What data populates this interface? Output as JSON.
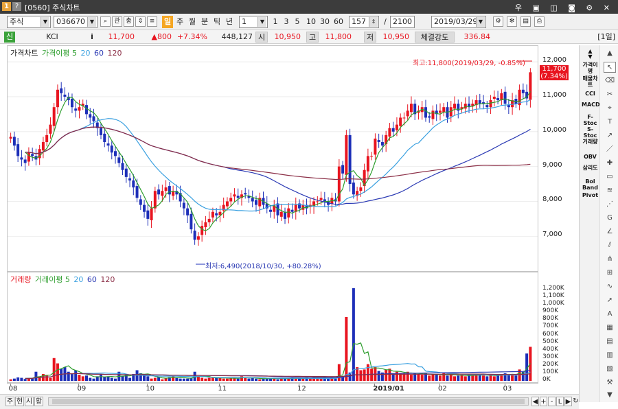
{
  "window": {
    "number": "1",
    "help": "?",
    "title": "[0560] 주식차트",
    "icons": "우 ▣ ◫ ◙ ⚙ ✕"
  },
  "toolbar": {
    "market": "주식",
    "code": "036670",
    "btn_gwan": "관",
    "btn_chong": "총",
    "period_tabs": [
      "일",
      "주",
      "월",
      "분",
      "틱",
      "년"
    ],
    "active_period": "일",
    "interval": "1",
    "quick_intervals": [
      "1",
      "3",
      "5",
      "10",
      "30",
      "60"
    ],
    "count": "157",
    "slash": "/",
    "total": "2100",
    "date": "2019/03/29"
  },
  "quote": {
    "badge": "신",
    "name": "KCI",
    "info": "i",
    "price": "11,700",
    "change": "▲800",
    "change_pct": "+7.34%",
    "volume": "448,127",
    "open_label": "시",
    "open": "10,950",
    "high_label": "고",
    "high": "11,800",
    "low_label": "저",
    "low": "10,950",
    "strength_label": "체결강도",
    "strength": "336.84",
    "period_label": "[1일]"
  },
  "price_panel": {
    "legend": [
      {
        "label": "가격차트",
        "color": "#222222"
      },
      {
        "label": "가격이평 5",
        "color": "#2e9e2e"
      },
      {
        "label": "20",
        "color": "#3aa0e0"
      },
      {
        "label": "60",
        "color": "#2b3ab4"
      },
      {
        "label": "120",
        "color": "#8b2e46"
      }
    ],
    "high_note": "최고:11,800(2019/03/29, -0.85%)",
    "low_note": "최저:6,490(2018/10/30, +80.28%)",
    "last_price": "11,700",
    "last_pct": "(7.34%)"
  },
  "volume_panel": {
    "legend": [
      {
        "label": "거래량",
        "color": "#e8141f"
      },
      {
        "label": "거래이평 5",
        "color": "#2e9e2e"
      },
      {
        "label": "20",
        "color": "#3aa0e0"
      },
      {
        "label": "60",
        "color": "#2b3ab4"
      },
      {
        "label": "120",
        "color": "#8b2e46"
      }
    ]
  },
  "colors": {
    "up": "#e8141f",
    "down": "#1d2fb8",
    "ma5": "#2e9e2e",
    "ma20": "#3aa0e0",
    "ma60": "#2b3ab4",
    "ma120": "#8b2e46"
  },
  "chart_data": [
    {
      "type": "candlestick",
      "title": "",
      "ylim": [
        6200,
        12100
      ],
      "yticks": [
        "12,000",
        "11,000",
        "10,000",
        "9,000",
        "8,000",
        "7,000"
      ],
      "ytick_values": [
        12000,
        11000,
        10000,
        9000,
        8000,
        7000
      ],
      "x_labels": [
        "08",
        "09",
        "10",
        "11",
        "12",
        "2019/01",
        "02",
        "03"
      ],
      "x_label_index": [
        0,
        19,
        38,
        58,
        80,
        101,
        119,
        137
      ],
      "close": [
        9850,
        9600,
        9300,
        9200,
        9100,
        9400,
        9300,
        9200,
        9500,
        9700,
        9900,
        10200,
        10700,
        11200,
        11100,
        11000,
        10900,
        10700,
        10600,
        10700,
        10800,
        10500,
        10400,
        10300,
        10100,
        9900,
        9700,
        9600,
        9400,
        9300,
        9100,
        8900,
        8700,
        8600,
        8400,
        8100,
        7900,
        7700,
        7500,
        7800,
        8300,
        8200,
        8300,
        8400,
        8200,
        8300,
        8200,
        8000,
        7800,
        7600,
        7200,
        6900,
        7000,
        7300,
        7400,
        7500,
        7700,
        7600,
        7700,
        7900,
        8000,
        8100,
        8200,
        8100,
        8200,
        8200,
        8100,
        8000,
        7900,
        8100,
        7900,
        7800,
        7700,
        7900,
        7600,
        7700,
        7500,
        7800,
        7700,
        7900,
        7800,
        7900,
        7800,
        7900,
        8000,
        8000,
        8100,
        8000,
        7900,
        8100,
        8000,
        9000,
        8800,
        9900,
        8500,
        8200,
        8300,
        8400,
        8900,
        9300,
        9300,
        9800,
        9700,
        9600,
        9900,
        10100,
        10000,
        10200,
        10400,
        10400,
        10600,
        10800,
        10500,
        10600,
        10700,
        10400,
        10400,
        10600,
        10500,
        10600,
        10700,
        10400,
        10700,
        10800,
        10600,
        10700,
        10800,
        10700,
        10800,
        10900,
        10800,
        10800,
        10700,
        10900,
        11000,
        10900,
        11100,
        10800,
        10700,
        10900,
        10800,
        11200,
        11100,
        10950,
        11700
      ],
      "volume_k": [
        20,
        30,
        45,
        40,
        25,
        30,
        35,
        120,
        60,
        90,
        70,
        40,
        300,
        230,
        160,
        180,
        120,
        90,
        140,
        80,
        60,
        70,
        40,
        30,
        60,
        80,
        50,
        60,
        40,
        30,
        120,
        60,
        80,
        40,
        90,
        140,
        100,
        70,
        60,
        30,
        40,
        50,
        20,
        40,
        50,
        60,
        40,
        30,
        30,
        30,
        40,
        120,
        60,
        40,
        30,
        40,
        50,
        40,
        40,
        30,
        30,
        40,
        40,
        30,
        60,
        40,
        30,
        40,
        30,
        20,
        30,
        30,
        40,
        30,
        20,
        40,
        30,
        30,
        40,
        30,
        30,
        30,
        40,
        30,
        40,
        30,
        30,
        40,
        30,
        40,
        30,
        220,
        60,
        840,
        110,
        1220,
        180,
        140,
        150,
        220,
        160,
        180,
        130,
        110,
        150,
        160,
        90,
        120,
        100,
        100,
        120,
        80,
        100,
        90,
        80,
        100,
        70,
        90,
        80,
        70,
        100,
        70,
        90,
        60,
        70,
        80,
        60,
        80,
        70,
        90,
        80,
        70,
        60,
        80,
        60,
        90,
        80,
        100,
        80,
        90,
        70,
        150,
        120,
        360,
        448
      ]
    },
    {
      "type": "bar",
      "title": "",
      "ylim": [
        0,
        1300
      ],
      "yticks": [
        "1,200K",
        "1,100K",
        "1,000K",
        "900K",
        "800K",
        "700K",
        "600K",
        "500K",
        "400K",
        "300K",
        "200K",
        "100K",
        "0K"
      ],
      "ytick_values": [
        1200,
        1100,
        1000,
        900,
        800,
        700,
        600,
        500,
        400,
        300,
        200,
        100,
        0
      ]
    }
  ],
  "toolbox": {
    "items": [
      "가격이평",
      "매물차트",
      "CCI",
      "MACD",
      "F-Stoc",
      "S-Stoc",
      "거래량",
      "OBV",
      "삼리도",
      "Bol Band",
      "Pivot"
    ]
  },
  "bottom": {
    "buttons": [
      "주",
      "현",
      "시",
      "황"
    ],
    "nav": [
      "◀",
      "+",
      "-",
      "L",
      "▶",
      "↻"
    ]
  }
}
